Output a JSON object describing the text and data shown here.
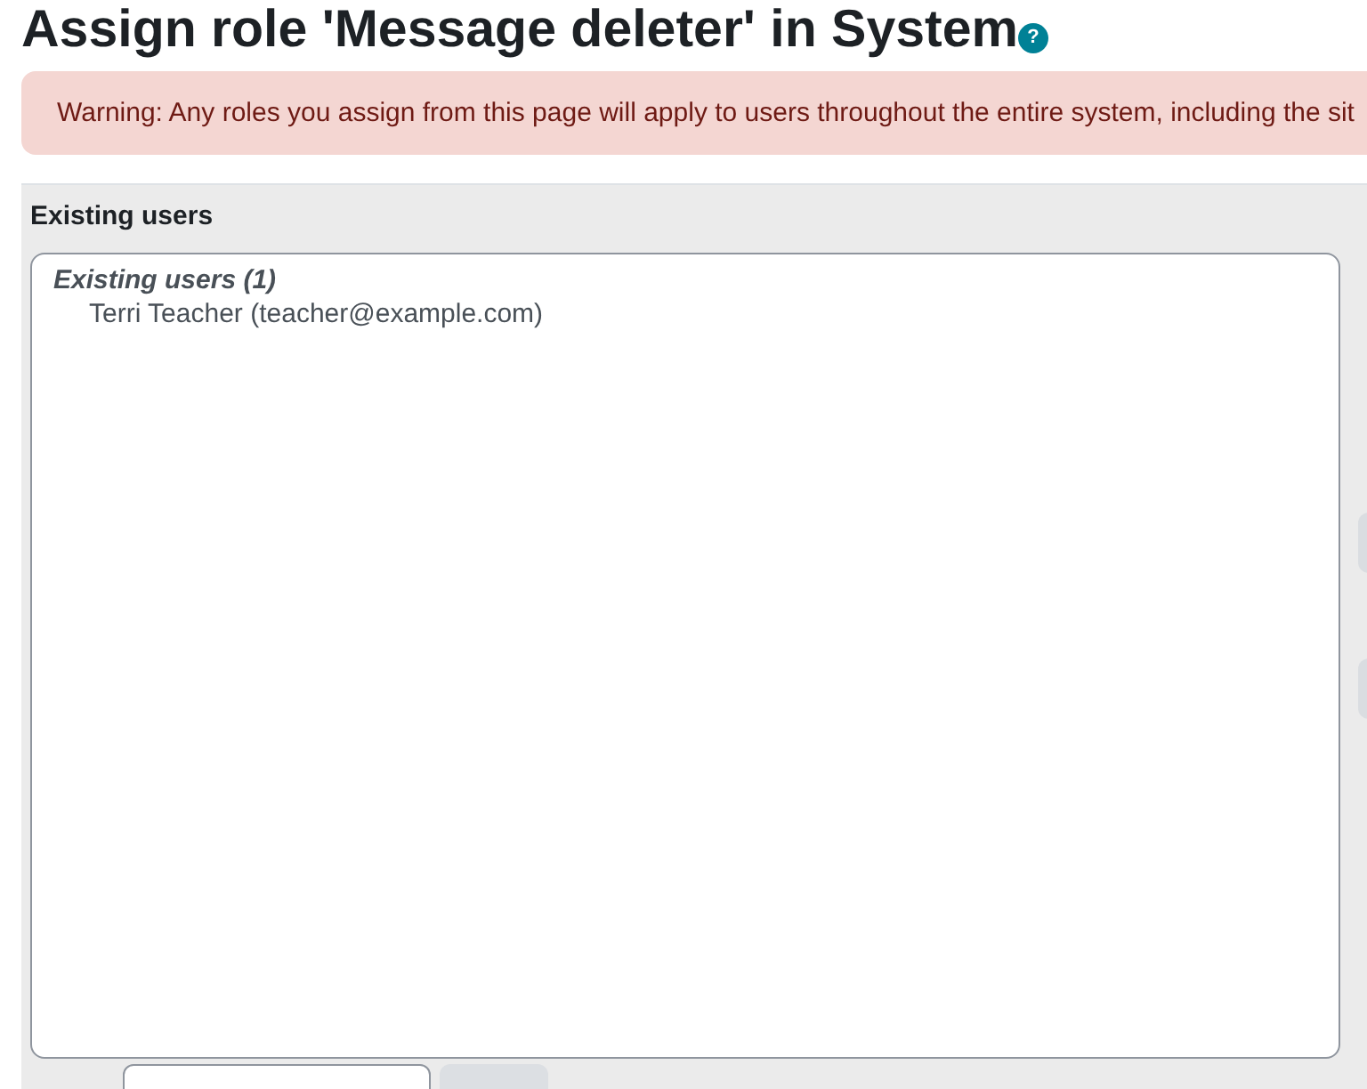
{
  "heading": {
    "title": "Assign role 'Message deleter' in System",
    "help_icon": "?"
  },
  "alert": {
    "text": "Warning: Any roles you assign from this page will apply to users throughout the entire system, including the sit"
  },
  "existing": {
    "label": "Existing users",
    "list": {
      "group_label": "Existing users (1)",
      "options": [
        {
          "text": "Terri Teacher (teacher@example.com)",
          "selected": false
        }
      ]
    }
  }
}
